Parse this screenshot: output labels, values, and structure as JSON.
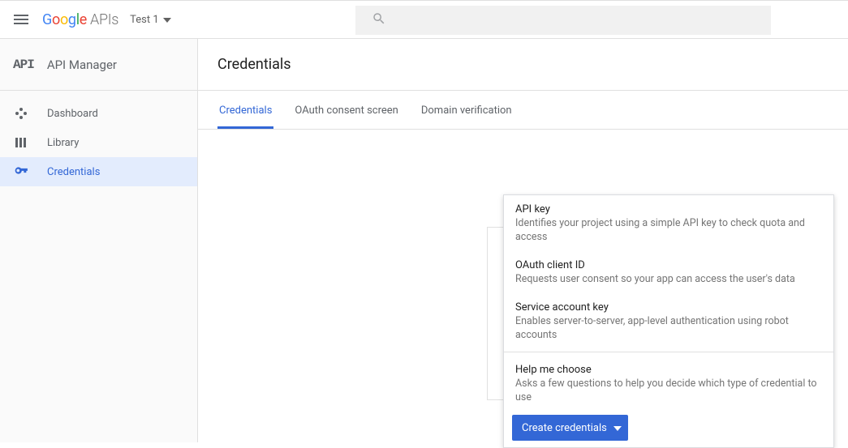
{
  "header": {
    "project_name": "Test 1"
  },
  "sidebar": {
    "title": "API Manager",
    "items": [
      {
        "label": "Dashboard"
      },
      {
        "label": "Library"
      },
      {
        "label": "Credentials"
      }
    ]
  },
  "page": {
    "title": "Credentials",
    "tabs": [
      {
        "label": "Credentials"
      },
      {
        "label": "OAuth consent screen"
      },
      {
        "label": "Domain verification"
      }
    ]
  },
  "create_menu": {
    "button_label": "Create credentials",
    "options": [
      {
        "title": "API key",
        "desc": "Identifies your project using a simple API key to check quota and access"
      },
      {
        "title": "OAuth client ID",
        "desc": "Requests user consent so your app can access the user's data"
      },
      {
        "title": "Service account key",
        "desc": "Enables server-to-server, app-level authentication using robot accounts"
      }
    ],
    "help": {
      "title": "Help me choose",
      "desc": "Asks a few questions to help you decide which type of credential to use"
    }
  }
}
